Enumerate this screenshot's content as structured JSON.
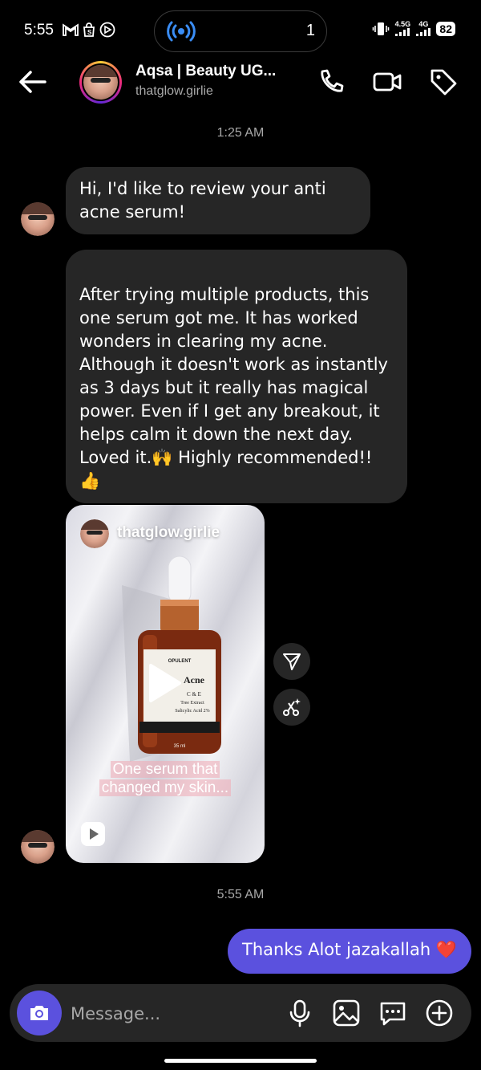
{
  "status_bar": {
    "time": "5:55",
    "island_count": "1",
    "network_1": "4.5G",
    "network_2": "4G",
    "battery": "82"
  },
  "header": {
    "name": "Aqsa | Beauty UG...",
    "username": "thatglow.girlie",
    "icons": [
      "back-arrow-icon",
      "phone-icon",
      "video-icon",
      "tag-icon"
    ]
  },
  "conversation": {
    "timestamp_1": "1:25 AM",
    "msg_1": "Hi, I'd like to review your anti acne serum!",
    "msg_2": "After trying multiple products, this one serum got me. It has worked wonders in clearing my acne. Although it doesn't work as instantly as 3 days but it really has magical power. Even if I get any breakout, it helps calm it down the next day.\nLoved it.🙌 Highly recommended!! 👍",
    "shared_post": {
      "username": "thatglow.girlie",
      "caption_line_1": "One serum that",
      "caption_line_2": "changed my skin...",
      "bottle_brand": "OPULENT",
      "bottle_label": "Acne",
      "bottle_line_1": "C & E",
      "bottle_line_2": "Tree Extract",
      "bottle_line_3": "Salicylic Acid 2%",
      "bottle_volume": "35 ml"
    },
    "timestamp_2": "5:55 AM",
    "msg_out": "Thanks Alot jazakallah ❤️"
  },
  "composer": {
    "placeholder": "Message..."
  },
  "colors": {
    "background": "#000000",
    "incoming_bubble": "#262626",
    "outgoing_bubble": "#5b51de",
    "secondary_text": "#a8a8a8"
  }
}
